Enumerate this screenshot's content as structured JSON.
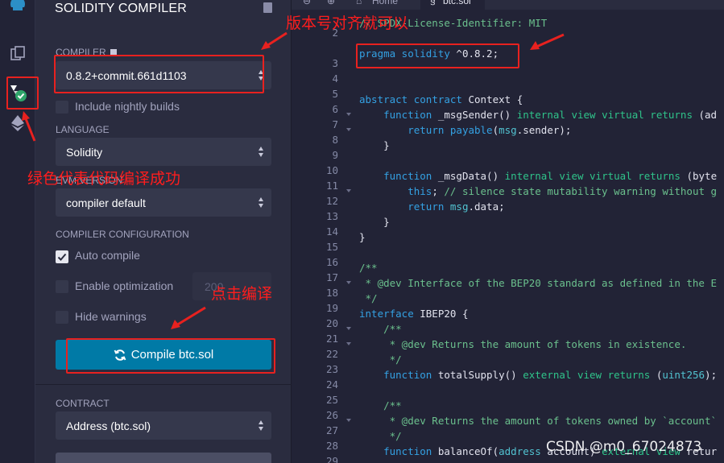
{
  "panel": {
    "title": "SOLIDITY COMPILER",
    "compiler_label": "COMPILER",
    "compiler_value": "0.8.2+commit.661d1103",
    "include_nightly_label": "Include nightly builds",
    "language_label": "LANGUAGE",
    "language_value": "Solidity",
    "evm_label": "EVM VERSION",
    "evm_value": "compiler default",
    "config_label": "COMPILER CONFIGURATION",
    "auto_compile_label": "Auto compile",
    "enable_optimization_label": "Enable optimization",
    "runs_value": "200",
    "hide_warnings_label": "Hide warnings",
    "compile_button_label": "Compile btc.sol",
    "contract_label": "CONTRACT",
    "contract_value": "Address (btc.sol)",
    "checkboxes": {
      "include_nightly": false,
      "auto_compile": true,
      "enable_optimization": false,
      "hide_warnings": false
    }
  },
  "editor": {
    "tabs": {
      "home": "Home",
      "file": "btc.sol"
    },
    "line_numbers": [
      "2",
      "3",
      "4",
      "5",
      "6",
      "7",
      "8",
      "9",
      "10",
      "11",
      "12",
      "13",
      "14",
      "15",
      "16",
      "17",
      "18",
      "19",
      "20",
      "21",
      "22",
      "23",
      "24",
      "25",
      "26",
      "27",
      "28",
      "29"
    ],
    "lines": {
      "l2": "// SPDX-License-Identifier: MIT",
      "l3_kw": "pragma solidity",
      "l3_rest": " ^0.8.2;",
      "l6": "abstract contract Context {",
      "l7": "    function _msgSender() internal view virtual returns (ad",
      "l8": "        return payable(msg.sender);",
      "l9": "    }",
      "l11": "    function _msgData() internal view virtual returns (byte",
      "l12": "        this; // silence state mutability warning without g",
      "l13": "        return msg.data;",
      "l14": "    }",
      "l15": "}",
      "l17": "/**",
      "l18": " * @dev Interface of the BEP20 standard as defined in the E",
      "l19": " */",
      "l20": "interface IBEP20 {",
      "l21": "    /**",
      "l22": "     * @dev Returns the amount of tokens in existence.",
      "l23": "     */",
      "l24": "    function totalSupply() external view returns (uint256);",
      "l26": "    /**",
      "l27": "     * @dev Returns the amount of tokens owned by `account`",
      "l28": "     */",
      "l29": "    function balanceOf(address account) external view retur"
    }
  },
  "annotations": {
    "version_note": "版本号对齐就可以",
    "success_note": "绿色代表代码编译成功",
    "click_note": "点击编译"
  },
  "watermark": "CSDN @m0_67024873",
  "colors": {
    "accent": "#007aa6",
    "annotation": "#e8211f",
    "success": "#2ea56a"
  }
}
